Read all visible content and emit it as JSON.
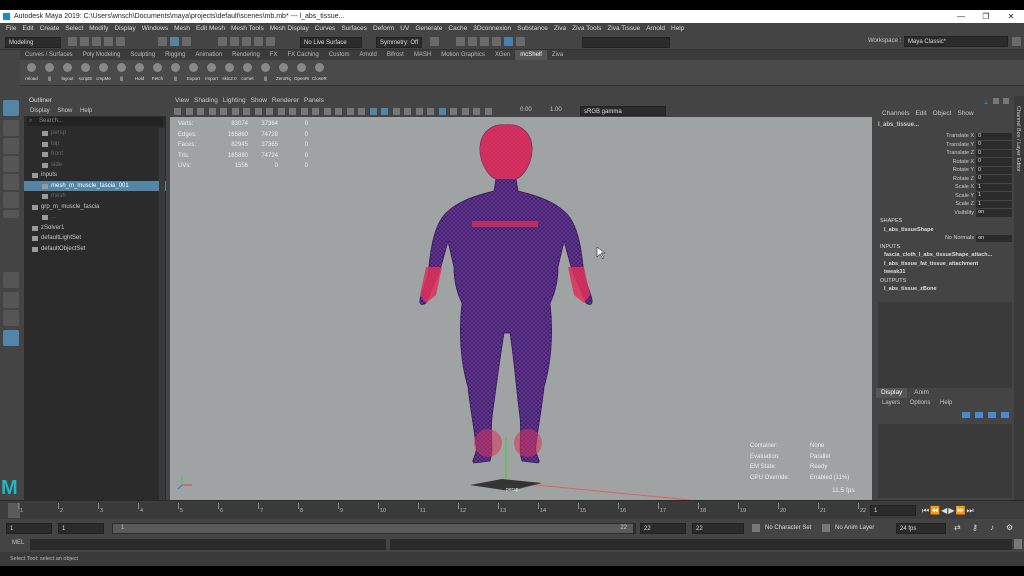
{
  "window": {
    "title": "Autodesk Maya 2019: C:\\Users\\wnsch\\Documents\\maya\\projects\\default\\scenes\\mb.mb* --- l_abs_tissue...",
    "controls": [
      "—",
      "❐",
      "✕"
    ]
  },
  "menubar": [
    "File",
    "Edit",
    "Create",
    "Select",
    "Modify",
    "Display",
    "Windows",
    "Mesh",
    "Edit Mesh",
    "Mesh Tools",
    "Mesh Display",
    "Curves",
    "Surfaces",
    "Deform",
    "UV",
    "Generate",
    "Cache",
    "3Dconnexion",
    "Substance",
    "Ziva",
    "Ziva Tools",
    "Ziva Tissue",
    "Arnold",
    "Help"
  ],
  "statusline": {
    "mode": "Modeling",
    "live_surface": "No Live Surface",
    "symmetry": "Symmetry: Off",
    "workspace_label": "Workspace :",
    "workspace_value": "Maya Classic*"
  },
  "shelf_tabs": [
    "Curves / Surfaces",
    "Poly Modeling",
    "Sculpting",
    "Rigging",
    "Animation",
    "Rendering",
    "FX",
    "FX Caching",
    "Custom",
    "Arnold",
    "Bifrost",
    "MASH",
    "Motion Graphics",
    "XGen",
    "mcShelf",
    "Ziva"
  ],
  "shelf_active": "mcShelf",
  "shelf_tools": [
    "reload",
    "|||",
    "layout",
    "scriptE",
    "cmpMe",
    "|||",
    "Hold",
    "Fetch",
    "|||",
    "Export",
    "Import",
    "skin2.0",
    "comet",
    "|||",
    "ZeroRig",
    "OpenRi",
    "CloseRi"
  ],
  "outliner": {
    "title": "Outliner",
    "menu": [
      "Display",
      "Show",
      "Help"
    ],
    "search_placeholder": "Search...",
    "items": [
      {
        "label": "persp",
        "dim": true,
        "indent": 1
      },
      {
        "label": "top",
        "dim": true,
        "indent": 1
      },
      {
        "label": "front",
        "dim": true,
        "indent": 1
      },
      {
        "label": "side",
        "dim": true,
        "indent": 1
      },
      {
        "label": "inputs",
        "dim": false,
        "indent": 0
      },
      {
        "label": "mesh_m_muscle_fascia_001",
        "dim": false,
        "indent": 1,
        "selected": true
      },
      {
        "label": "mesh",
        "dim": true,
        "indent": 1
      },
      {
        "label": "grp_m_muscle_fascia",
        "dim": false,
        "indent": 0
      },
      {
        "label": "...",
        "dim": true,
        "indent": 1
      },
      {
        "label": "zSolver1",
        "dim": false,
        "indent": 0
      },
      {
        "label": "defaultLightSet",
        "dim": false,
        "indent": 0
      },
      {
        "label": "defaultObjectSet",
        "dim": false,
        "indent": 0
      }
    ]
  },
  "panel_menu": [
    "View",
    "Shading",
    "Lighting",
    "Show",
    "Renderer",
    "Panels"
  ],
  "panel_toolbar": {
    "exposure": "0.00",
    "gamma": "1.00",
    "colorspace": "sRGB gamma"
  },
  "hud_stats": [
    {
      "label": "Verts:",
      "v1": "83074",
      "v2": "37364",
      "v3": "0"
    },
    {
      "label": "Edges:",
      "v1": "165860",
      "v2": "74728",
      "v3": "0"
    },
    {
      "label": "Faces:",
      "v1": "82945",
      "v2": "37365",
      "v3": "0"
    },
    {
      "label": "Tris:",
      "v1": "165880",
      "v2": "74724",
      "v3": "0"
    },
    {
      "label": "UVs:",
      "v1": "1556",
      "v2": "0",
      "v3": "0"
    }
  ],
  "hud_eval": [
    {
      "label": "Container:",
      "value": "None"
    },
    {
      "label": "Evaluation:",
      "value": "Parallel"
    },
    {
      "label": "EM State:",
      "value": "Ready"
    },
    {
      "label": "GPU Override:",
      "value": "Enabled (11%)"
    }
  ],
  "fps": "11.5 fps",
  "camera_label": "persp",
  "channelbox": {
    "menu": [
      "Channels",
      "Edit",
      "Object",
      "Show"
    ],
    "object": "l_abs_tissue...",
    "attrs": [
      {
        "name": "Translate X",
        "value": "0"
      },
      {
        "name": "Translate Y",
        "value": "0"
      },
      {
        "name": "Translate Z",
        "value": "0"
      },
      {
        "name": "Rotate X",
        "value": "0"
      },
      {
        "name": "Rotate Y",
        "value": "0"
      },
      {
        "name": "Rotate Z",
        "value": "0"
      },
      {
        "name": "Scale X",
        "value": "1"
      },
      {
        "name": "Scale Y",
        "value": "1"
      },
      {
        "name": "Scale Z",
        "value": "1"
      },
      {
        "name": "Visibility",
        "value": "on"
      }
    ],
    "shapes_label": "SHAPES",
    "shape_name": "l_abs_tissueShape",
    "shape_attr_name": "No Normals",
    "shape_attr_value": "on",
    "inputs_label": "INPUTS",
    "inputs": [
      "fascia_cloth_l_abs_tissueShape_attach...",
      "l_abs_tissue_fat_tissue_attachment",
      "tweak31"
    ],
    "outputs_label": "OUTPUTS",
    "outputs": [
      "l_abs_tissue_zBone"
    ]
  },
  "layer_panel": {
    "tabs": [
      "Display",
      "Anim"
    ],
    "menu": [
      "Layers",
      "Options",
      "Help"
    ]
  },
  "side_tab": "Channel Box / Layer Editor",
  "timeline": {
    "ticks": [
      "1",
      "2",
      "3",
      "4",
      "5",
      "6",
      "7",
      "8",
      "9",
      "10",
      "11",
      "12",
      "13",
      "14",
      "15",
      "16",
      "17",
      "18",
      "19",
      "20",
      "21",
      "22"
    ],
    "current_frame": "1"
  },
  "range": {
    "start": "1",
    "playback_start": "1",
    "slider_start": "1",
    "slider_end": "22",
    "playback_end": "22",
    "end": "22",
    "character_set": "No Character Set",
    "anim_layer": "No Anim Layer",
    "fps": "24 fps"
  },
  "cmdline": {
    "label": "MEL"
  },
  "helpline": "Select Tool: select an object"
}
